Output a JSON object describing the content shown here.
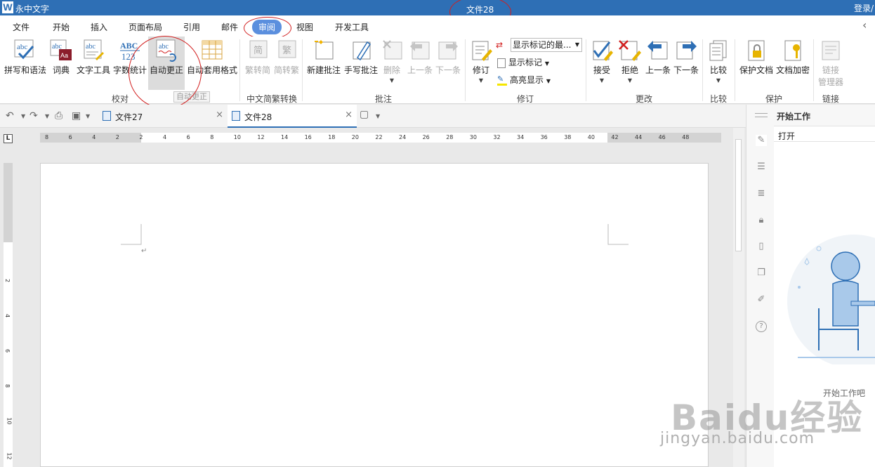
{
  "window": {
    "app_name": "永中文字",
    "title": "文件28",
    "login": "登录/"
  },
  "menu": {
    "tabs": [
      {
        "label": "文件"
      },
      {
        "label": "开始"
      },
      {
        "label": "插入"
      },
      {
        "label": "页面布局"
      },
      {
        "label": "引用"
      },
      {
        "label": "邮件"
      },
      {
        "label": "审阅",
        "active": true
      },
      {
        "label": "视图"
      },
      {
        "label": "开发工具"
      }
    ]
  },
  "ribbon": {
    "proofing": {
      "label": "校对",
      "spell": "拼写和语法",
      "dictionary": "词典",
      "text_tools": "文字工具",
      "word_count": "字数统计",
      "autocorrect": "自动更正",
      "autoformat": "自动套用格式"
    },
    "chinese_conversion": {
      "label": "中文简繁转换",
      "trad_to_simp": "繁转简",
      "simp_to_trad": "简转繁",
      "icon_simp": "简",
      "icon_trad": "繁"
    },
    "comments": {
      "label": "批注",
      "new_comment": "新建批注",
      "handwritten": "手写批注",
      "delete": "删除",
      "previous": "上一条",
      "next": "下一条"
    },
    "revision": {
      "label": "修订",
      "track": "修订",
      "markup_view": "显示标记的最...",
      "show_markup": "显示标记",
      "highlight": "高亮显示"
    },
    "changes": {
      "label": "更改",
      "accept": "接受",
      "reject": "拒绝",
      "previous": "上一条",
      "next": "下一条"
    },
    "compare": {
      "label": "比较",
      "compare": "比较"
    },
    "protect": {
      "label": "保护",
      "protect_doc": "保护文档",
      "encrypt_doc": "文档加密"
    },
    "link": {
      "label": "链接",
      "link_manager_line1": "链接",
      "link_manager_line2": "管理器"
    },
    "tooltip": "自动更正"
  },
  "documents": {
    "tabs": [
      {
        "title": "文件27"
      },
      {
        "title": "文件28",
        "active": true
      }
    ]
  },
  "ruler": {
    "horizontal_ticks": [
      "8",
      "6",
      "4",
      "2",
      "2",
      "4",
      "6",
      "8",
      "10",
      "12",
      "14",
      "16",
      "18",
      "20",
      "22",
      "24",
      "26",
      "28",
      "30",
      "32",
      "34",
      "36",
      "38",
      "40",
      "42",
      "44",
      "46",
      "48"
    ],
    "vertical_ticks": [
      "2",
      "4",
      "6",
      "8",
      "10",
      "12"
    ]
  },
  "taskpane": {
    "title": "开始工作",
    "open": "打开",
    "start_prompt": "开始工作吧"
  },
  "colors": {
    "title_bar": "#2e6fb5",
    "active_tab": "#5b8fde",
    "annotation": "#d21f1f"
  },
  "icons": {
    "side": [
      "pen-icon",
      "sliders-icon",
      "list-tree-icon",
      "lock-icon",
      "clipboard-icon",
      "copy-icon",
      "edit-icon",
      "help-icon"
    ]
  },
  "watermark": {
    "logo": "Baidu经验",
    "url": "jingyan.baidu.com"
  }
}
